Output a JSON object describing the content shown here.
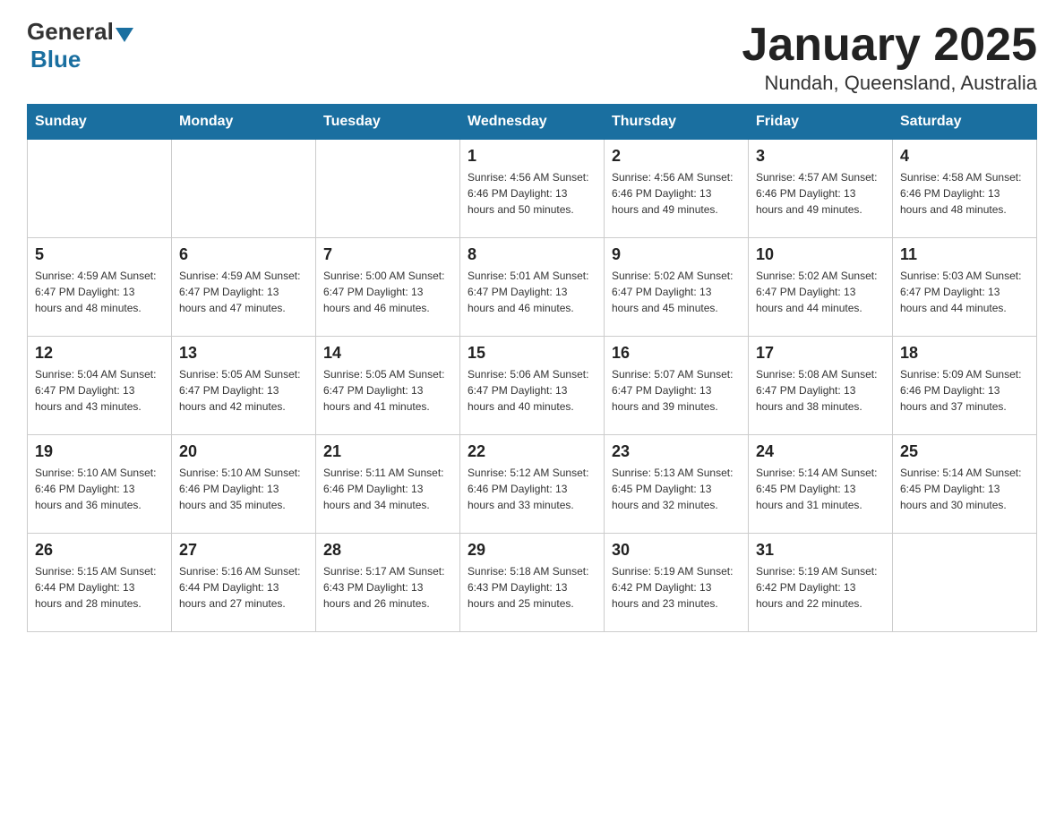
{
  "logo": {
    "general": "General",
    "blue": "Blue"
  },
  "title": "January 2025",
  "subtitle": "Nundah, Queensland, Australia",
  "days_of_week": [
    "Sunday",
    "Monday",
    "Tuesday",
    "Wednesday",
    "Thursday",
    "Friday",
    "Saturday"
  ],
  "weeks": [
    [
      {
        "day": "",
        "info": ""
      },
      {
        "day": "",
        "info": ""
      },
      {
        "day": "",
        "info": ""
      },
      {
        "day": "1",
        "info": "Sunrise: 4:56 AM\nSunset: 6:46 PM\nDaylight: 13 hours\nand 50 minutes."
      },
      {
        "day": "2",
        "info": "Sunrise: 4:56 AM\nSunset: 6:46 PM\nDaylight: 13 hours\nand 49 minutes."
      },
      {
        "day": "3",
        "info": "Sunrise: 4:57 AM\nSunset: 6:46 PM\nDaylight: 13 hours\nand 49 minutes."
      },
      {
        "day": "4",
        "info": "Sunrise: 4:58 AM\nSunset: 6:46 PM\nDaylight: 13 hours\nand 48 minutes."
      }
    ],
    [
      {
        "day": "5",
        "info": "Sunrise: 4:59 AM\nSunset: 6:47 PM\nDaylight: 13 hours\nand 48 minutes."
      },
      {
        "day": "6",
        "info": "Sunrise: 4:59 AM\nSunset: 6:47 PM\nDaylight: 13 hours\nand 47 minutes."
      },
      {
        "day": "7",
        "info": "Sunrise: 5:00 AM\nSunset: 6:47 PM\nDaylight: 13 hours\nand 46 minutes."
      },
      {
        "day": "8",
        "info": "Sunrise: 5:01 AM\nSunset: 6:47 PM\nDaylight: 13 hours\nand 46 minutes."
      },
      {
        "day": "9",
        "info": "Sunrise: 5:02 AM\nSunset: 6:47 PM\nDaylight: 13 hours\nand 45 minutes."
      },
      {
        "day": "10",
        "info": "Sunrise: 5:02 AM\nSunset: 6:47 PM\nDaylight: 13 hours\nand 44 minutes."
      },
      {
        "day": "11",
        "info": "Sunrise: 5:03 AM\nSunset: 6:47 PM\nDaylight: 13 hours\nand 44 minutes."
      }
    ],
    [
      {
        "day": "12",
        "info": "Sunrise: 5:04 AM\nSunset: 6:47 PM\nDaylight: 13 hours\nand 43 minutes."
      },
      {
        "day": "13",
        "info": "Sunrise: 5:05 AM\nSunset: 6:47 PM\nDaylight: 13 hours\nand 42 minutes."
      },
      {
        "day": "14",
        "info": "Sunrise: 5:05 AM\nSunset: 6:47 PM\nDaylight: 13 hours\nand 41 minutes."
      },
      {
        "day": "15",
        "info": "Sunrise: 5:06 AM\nSunset: 6:47 PM\nDaylight: 13 hours\nand 40 minutes."
      },
      {
        "day": "16",
        "info": "Sunrise: 5:07 AM\nSunset: 6:47 PM\nDaylight: 13 hours\nand 39 minutes."
      },
      {
        "day": "17",
        "info": "Sunrise: 5:08 AM\nSunset: 6:47 PM\nDaylight: 13 hours\nand 38 minutes."
      },
      {
        "day": "18",
        "info": "Sunrise: 5:09 AM\nSunset: 6:46 PM\nDaylight: 13 hours\nand 37 minutes."
      }
    ],
    [
      {
        "day": "19",
        "info": "Sunrise: 5:10 AM\nSunset: 6:46 PM\nDaylight: 13 hours\nand 36 minutes."
      },
      {
        "day": "20",
        "info": "Sunrise: 5:10 AM\nSunset: 6:46 PM\nDaylight: 13 hours\nand 35 minutes."
      },
      {
        "day": "21",
        "info": "Sunrise: 5:11 AM\nSunset: 6:46 PM\nDaylight: 13 hours\nand 34 minutes."
      },
      {
        "day": "22",
        "info": "Sunrise: 5:12 AM\nSunset: 6:46 PM\nDaylight: 13 hours\nand 33 minutes."
      },
      {
        "day": "23",
        "info": "Sunrise: 5:13 AM\nSunset: 6:45 PM\nDaylight: 13 hours\nand 32 minutes."
      },
      {
        "day": "24",
        "info": "Sunrise: 5:14 AM\nSunset: 6:45 PM\nDaylight: 13 hours\nand 31 minutes."
      },
      {
        "day": "25",
        "info": "Sunrise: 5:14 AM\nSunset: 6:45 PM\nDaylight: 13 hours\nand 30 minutes."
      }
    ],
    [
      {
        "day": "26",
        "info": "Sunrise: 5:15 AM\nSunset: 6:44 PM\nDaylight: 13 hours\nand 28 minutes."
      },
      {
        "day": "27",
        "info": "Sunrise: 5:16 AM\nSunset: 6:44 PM\nDaylight: 13 hours\nand 27 minutes."
      },
      {
        "day": "28",
        "info": "Sunrise: 5:17 AM\nSunset: 6:43 PM\nDaylight: 13 hours\nand 26 minutes."
      },
      {
        "day": "29",
        "info": "Sunrise: 5:18 AM\nSunset: 6:43 PM\nDaylight: 13 hours\nand 25 minutes."
      },
      {
        "day": "30",
        "info": "Sunrise: 5:19 AM\nSunset: 6:42 PM\nDaylight: 13 hours\nand 23 minutes."
      },
      {
        "day": "31",
        "info": "Sunrise: 5:19 AM\nSunset: 6:42 PM\nDaylight: 13 hours\nand 22 minutes."
      },
      {
        "day": "",
        "info": ""
      }
    ]
  ]
}
